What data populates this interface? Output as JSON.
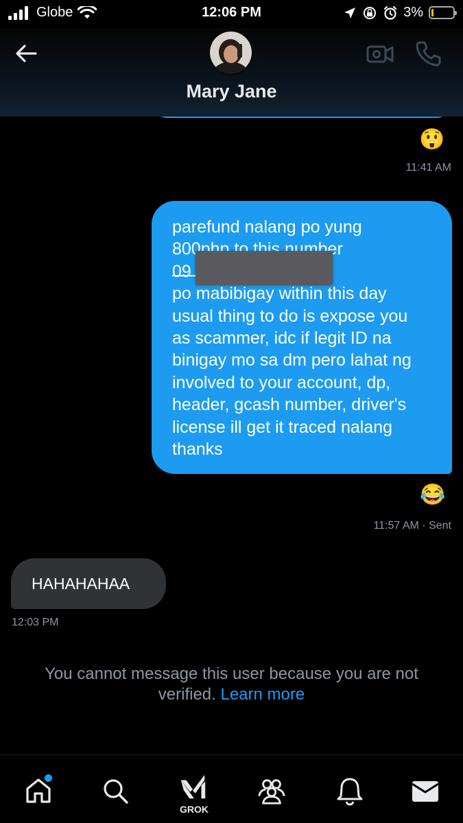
{
  "status_bar": {
    "carrier": "Globe",
    "time": "12:06 PM",
    "battery": "3%"
  },
  "header": {
    "contact_name": "Mary Jane"
  },
  "messages": [
    {
      "type": "reaction",
      "emoji": "😲"
    },
    {
      "type": "timestamp",
      "text": "11:41 AM"
    },
    {
      "type": "outgoing",
      "text": "parefund nalang po yung\n800php to this number\n09                              U, if di niyo\npo mabibigay within this day\nusual thing to do is expose you\nas scammer, idc if legit ID na\nbinigay mo sa dm pero lahat ng\ninvolved to your account, dp,\nheader, gcash number, driver's\nlicense ill get it traced nalang\nthanks"
    },
    {
      "type": "reaction",
      "emoji": "😂"
    },
    {
      "type": "timestamp",
      "text": "11:57 AM · Sent"
    },
    {
      "type": "incoming",
      "text": "HAHAHAHAA"
    },
    {
      "type": "timestamp",
      "text": "12:03 PM"
    }
  ],
  "notice": {
    "text": "You cannot message this user because you are not verified.",
    "link": "Learn more"
  },
  "nav": {
    "grok_label": "GROK",
    "icons": [
      "home-icon",
      "search-icon",
      "grok-icon",
      "communities-icon",
      "notifications-icon",
      "messages-icon"
    ]
  },
  "colors": {
    "accent": "#1d9bf0",
    "incoming_bubble": "#2f3336",
    "muted_text": "#8b98a5",
    "background": "#000000"
  }
}
